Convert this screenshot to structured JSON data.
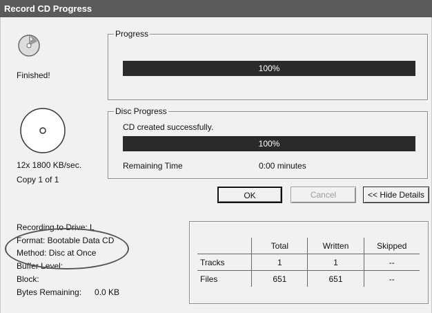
{
  "window": {
    "title": "Record CD Progress"
  },
  "left": {
    "status": "Finished!",
    "speed": "12x 1800 KB/sec.",
    "copy": "Copy 1 of 1"
  },
  "progress": {
    "label": "Progress",
    "percent_text": "100%",
    "value": 100
  },
  "disc_progress": {
    "label": "Disc Progress",
    "message": "CD created successfully.",
    "percent_text": "100%",
    "value": 100,
    "remaining_label": "Remaining Time",
    "remaining_value": "0:00 minutes"
  },
  "buttons": {
    "ok": "OK",
    "cancel": "Cancel",
    "hide_details": "<< Hide Details"
  },
  "details": {
    "recording_drive": "Recording to Drive: L",
    "format": "Format: Bootable Data CD",
    "method": "Method: Disc at Once",
    "buffer": "Buffer Level:",
    "block": "Block:",
    "bytes_label": "Bytes Remaining:",
    "bytes_value": "0.0 KB"
  },
  "stats": {
    "headers": [
      "Total",
      "Written",
      "Skipped"
    ],
    "rows": [
      {
        "label": "Tracks",
        "total": "1",
        "written": "1",
        "skipped": "--"
      },
      {
        "label": "Files",
        "total": "651",
        "written": "651",
        "skipped": "--"
      }
    ]
  },
  "icons": {
    "status": "cd-spin-icon",
    "disc": "cd-disc-icon"
  }
}
